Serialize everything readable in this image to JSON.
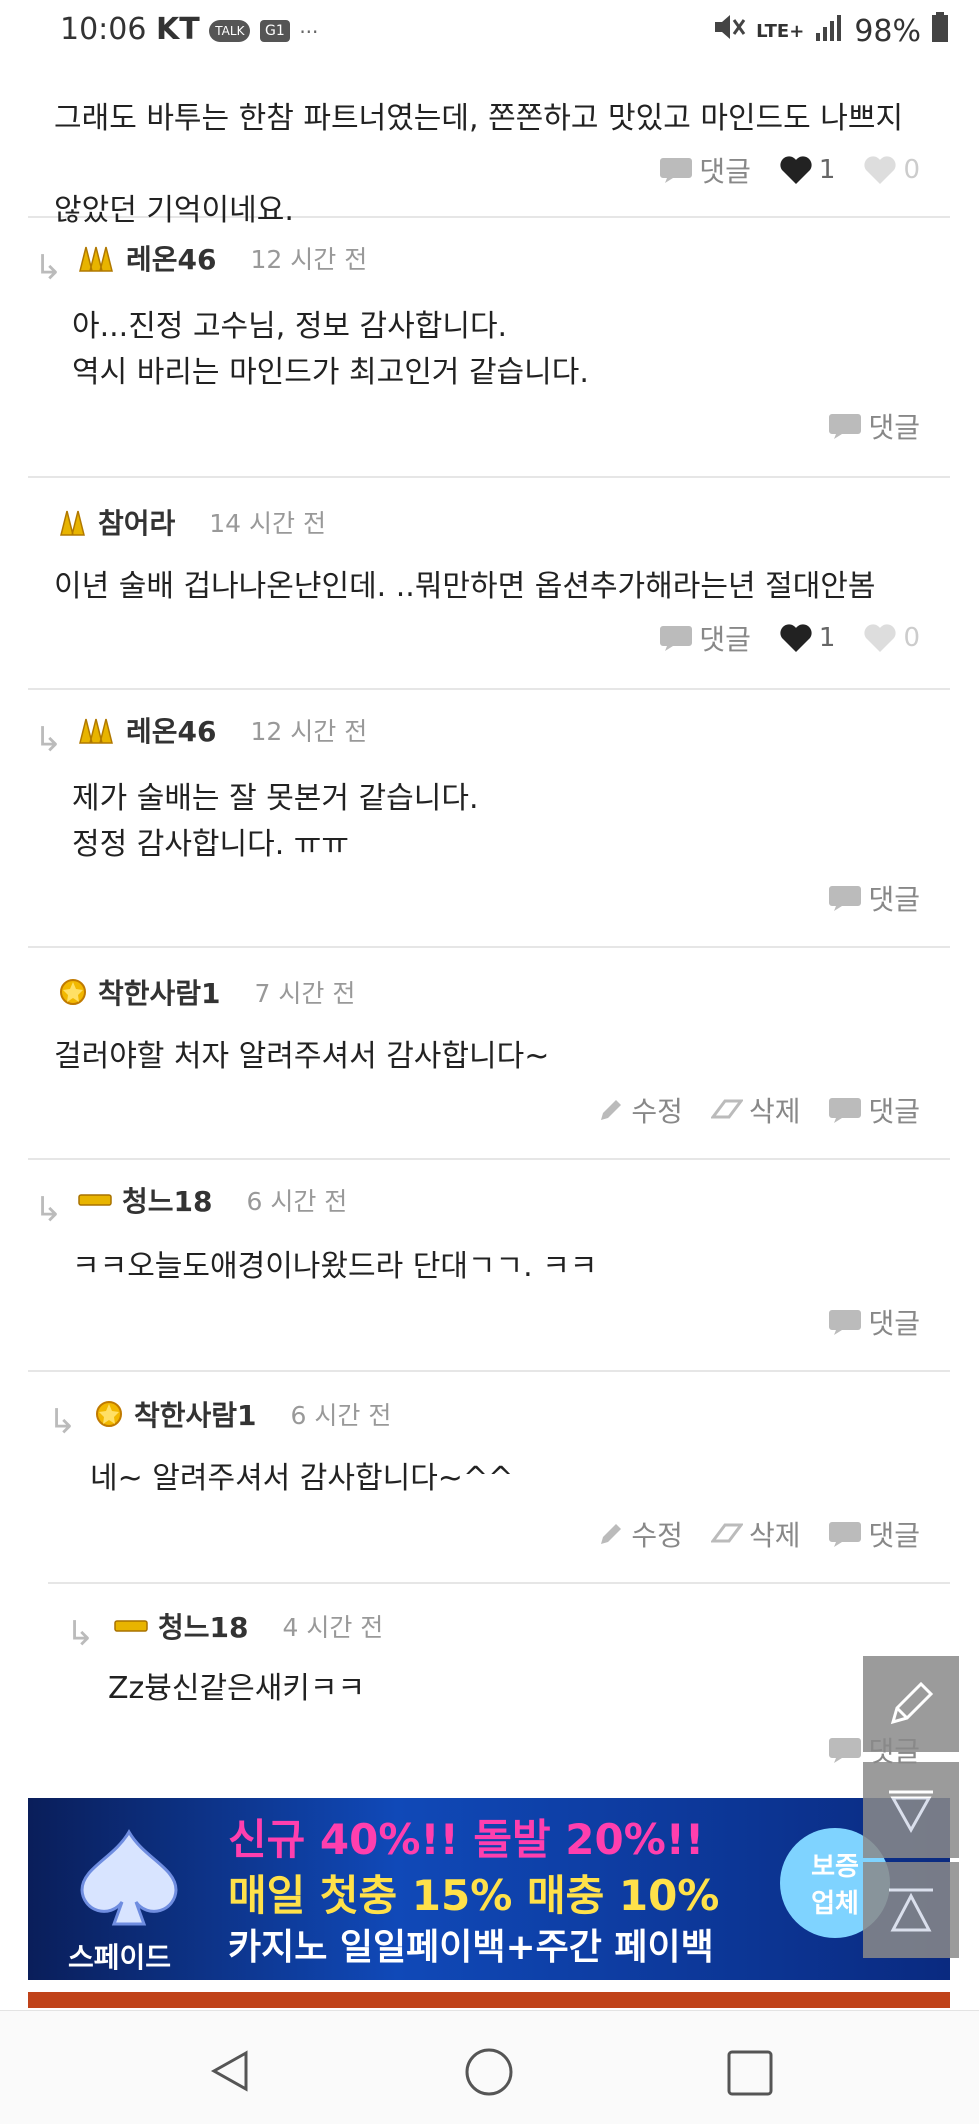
{
  "status_bar": {
    "time": "10:06",
    "carrier": "KT",
    "talk_badge": "TALK",
    "g_badge": "G1",
    "dots": "···",
    "network": "LTE+",
    "battery": "98%"
  },
  "labels": {
    "reply": "댓글",
    "edit": "수정",
    "delete": "삭제"
  },
  "top_partial": {
    "line1": "그래도 바투는 한참 파트너였는데, 쫀쫀하고 맛있고 마인드도 나쁘지",
    "line2": "않았던 기억이네요.",
    "likes": "1",
    "dislikes": "0"
  },
  "comments": [
    {
      "author": "레온46",
      "time": "12 시간 전",
      "text": "아...진정 고수님, 정보 감사합니다.\n역시 바리는 마인드가 최고인거 같습니다."
    },
    {
      "author": "참어라",
      "time": "14 시간 전",
      "text": "이년 술배 겁나나온냔인데. ..뭐만하면 옵션추가해라는년 절대안봄",
      "likes": "1",
      "dislikes": "0"
    },
    {
      "author": "레온46",
      "time": "12 시간 전",
      "text": "제가 술배는 잘 못본거 같습니다.\n정정 감사합니다. ㅠㅠ"
    },
    {
      "author": "착한사람1",
      "time": "7 시간 전",
      "text": "걸러야할 처자 알려주셔서 감사합니다~"
    },
    {
      "author": "청느18",
      "time": "6 시간 전",
      "text": "ㅋㅋ오늘도애경이나왔드라 단대ㄱㄱ. ㅋㅋ"
    },
    {
      "author": "착한사람1",
      "time": "6 시간 전",
      "text": "네~ 알려주셔서 감사합니다~^^"
    },
    {
      "author": "청느18",
      "time": "4 시간 전",
      "text": "Zz븅신같은새키ㅋㅋ"
    }
  ],
  "ad": {
    "brand": "스페이드",
    "line1": "신규 40%!!  돌발 20%!!",
    "line2": "매일 첫충 15% 매충 10%",
    "line3": "카지노 일일페이백+주간 페이백",
    "badge": "보증\n업체"
  }
}
